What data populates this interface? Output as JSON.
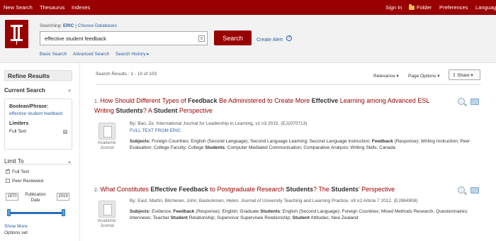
{
  "topbar": {
    "new_search": "New Search",
    "thesaurus": "Thesaurus",
    "indexes": "Indexes",
    "sign_in": "Sign In",
    "folder": "Folder",
    "preferences": "Preferences",
    "languages": "Languages"
  },
  "header": {
    "searching_label": "Searching:",
    "database": "ERIC",
    "separator": "|",
    "choose_db": "Choose Databases",
    "search_value": "effective student feedback",
    "search_button": "Search",
    "create_alert": "Create Alert",
    "help": "?",
    "clear": "x",
    "links": [
      "Basic Search",
      "Advanced Search",
      "Search History ▸"
    ]
  },
  "sidebar": {
    "title": "Refine Results",
    "current_search": "Current Search",
    "boolean_label": "Boolean/Phrase:",
    "boolean_value": "effective student feedback",
    "limiters_label": "Limiters",
    "limiter_value": "Full Text",
    "limit_to": "Limit To",
    "full_text": "Full Text",
    "peer_reviewed": "Peer Reviewed",
    "year_from": "1970",
    "year_to": "2019",
    "pub_date_label": "Publication Date",
    "show_more": "Show More",
    "options_set": "Options set",
    "colors": {
      "slider": "#2a6ebb"
    }
  },
  "main": {
    "results_count": "Search Results : 1 - 10 of 103",
    "relevance": "Relevance ▾",
    "page_options": "Page Options ▾",
    "share": "Share ▾"
  },
  "results": [
    {
      "num": "1.",
      "t1": "How Should Different Types of ",
      "b1": "Feedback",
      "t2": " Be Administered to Create More ",
      "b2": "Effective",
      "t3": " Learning among Advanced ESL Writing ",
      "b3": "Students",
      "t4": "? A ",
      "b4": "Student",
      "t5": " Perspective",
      "meta": "By: Bao, Ze. International Journal for Leadership in Learning, v1 n3 2015. (EJ1070713)",
      "fulltext": "FULL TEXT FROM ERIC",
      "doc_type": "Academic Journal",
      "subjects_label": "Subjects:",
      "s1": " Foreign Countries; English (Second Language); Second Language Learning; Second Language Instruction; ",
      "s2": "Feedback",
      "s3": " (Response); Writing Instruction; Peer Evaluation; College Faculty; College ",
      "s4": "Students",
      "s5": "; Computer Mediated Communication; Comparative Analysis; Writing Skills; Canada"
    },
    {
      "num": "2.",
      "t1": "What Constitutes ",
      "b1": "Effective Feedback",
      "t2": " to Postgraduate Research ",
      "b2": "Students",
      "t3": "? The ",
      "b3": "Students",
      "t4": "' Perspective",
      "meta": "By: East, Martin; Bitchener, John; Basturkmen, Helen. Journal of University Teaching and Learning Practice, v9 n2 Article 7 2012. (EJ984908)",
      "doc_type": "Academic Journal",
      "subjects_label": "Subjects:",
      "s1": " Evidence; ",
      "s2": "Feedback",
      "s3": " (Response); English; Graduate ",
      "s4": "Students",
      "s5": "; English (Second Language); Foreign Countries; Mixed Methods Research; Questionnaires; Interviews; Teacher ",
      "s6": "Student",
      "s7": " Relationship; Supervisor Supervisee Relationship; ",
      "s8": "Student",
      "s9": " Attitudes; New Zealand"
    }
  ],
  "colors": {
    "brand": "#990000",
    "link": "#2a5fa5"
  }
}
